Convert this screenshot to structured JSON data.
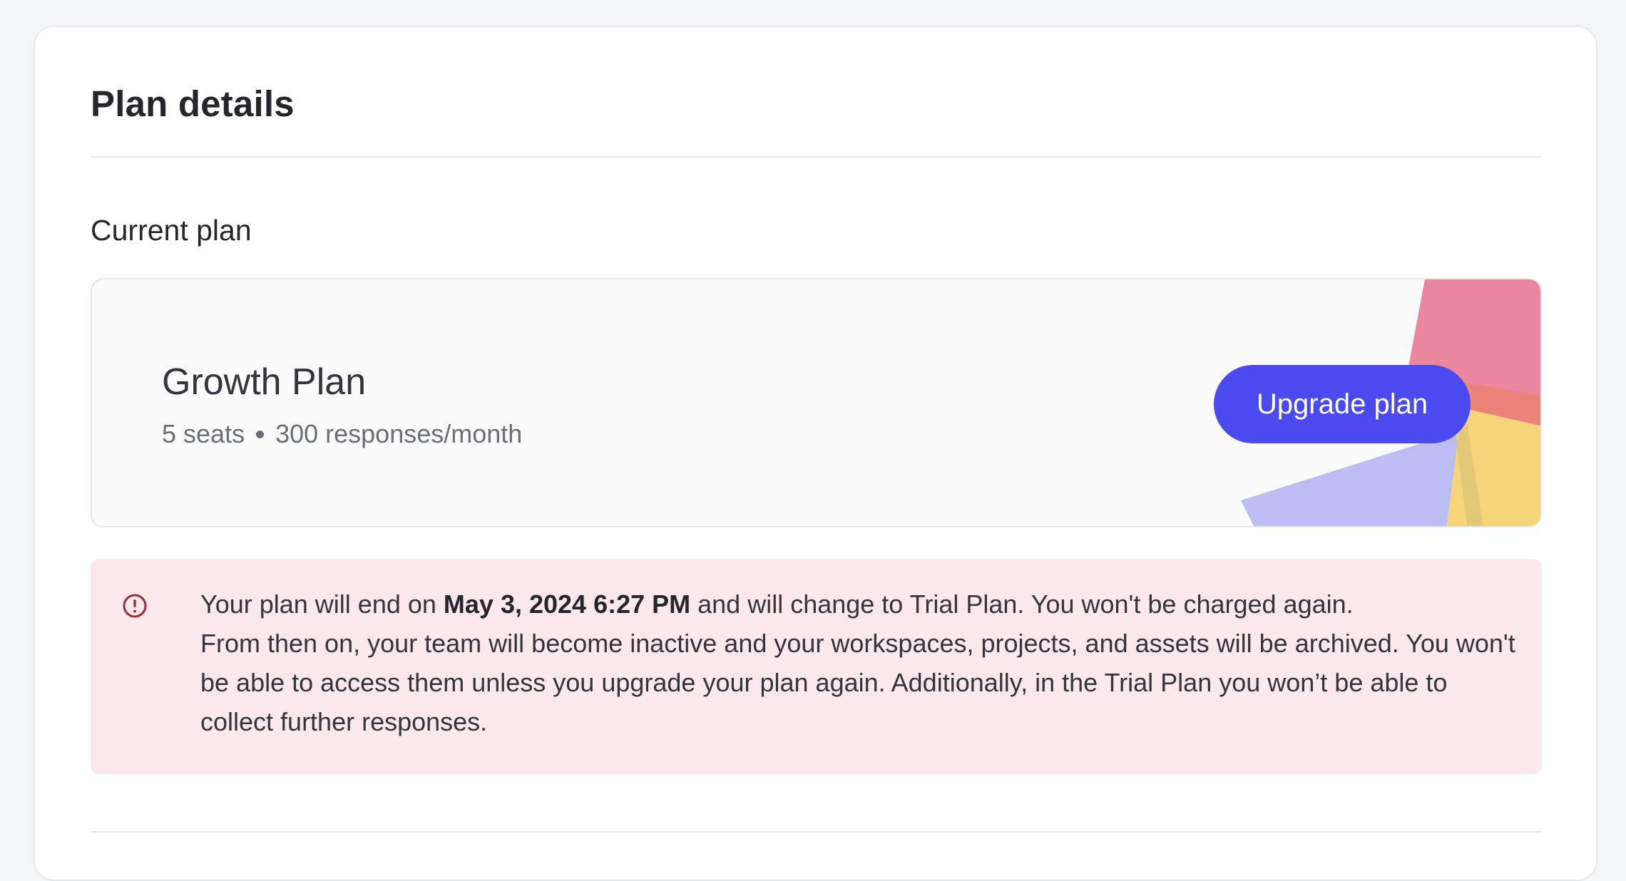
{
  "page": {
    "title": "Plan details"
  },
  "current_plan": {
    "section_title": "Current plan",
    "plan_name": "Growth Plan",
    "seats": "5 seats",
    "responses": "300 responses/month",
    "upgrade_label": "Upgrade plan"
  },
  "alert": {
    "icon": "exclamation-circle-icon",
    "line1_prefix": "Your plan will end on ",
    "end_date": "May 3, 2024 6:27 PM",
    "line1_suffix": " and will change to Trial Plan. You won't be charged again.",
    "body": "From then on, your team will become inactive and your workspaces, projects, and assets will be archived. You won't be able to access them unless you upgrade your plan again. Additionally, in the Trial Plan you won’t be able to collect further responses."
  },
  "colors": {
    "accent": "#4a4aef",
    "alert_bg": "#fbe8ec",
    "alert_icon": "#9b2c3a",
    "decor_pink": "#ea879e",
    "decor_yellow": "#f6d57a",
    "decor_lavender": "#bcbdf3",
    "decor_coral": "#ec8379"
  }
}
